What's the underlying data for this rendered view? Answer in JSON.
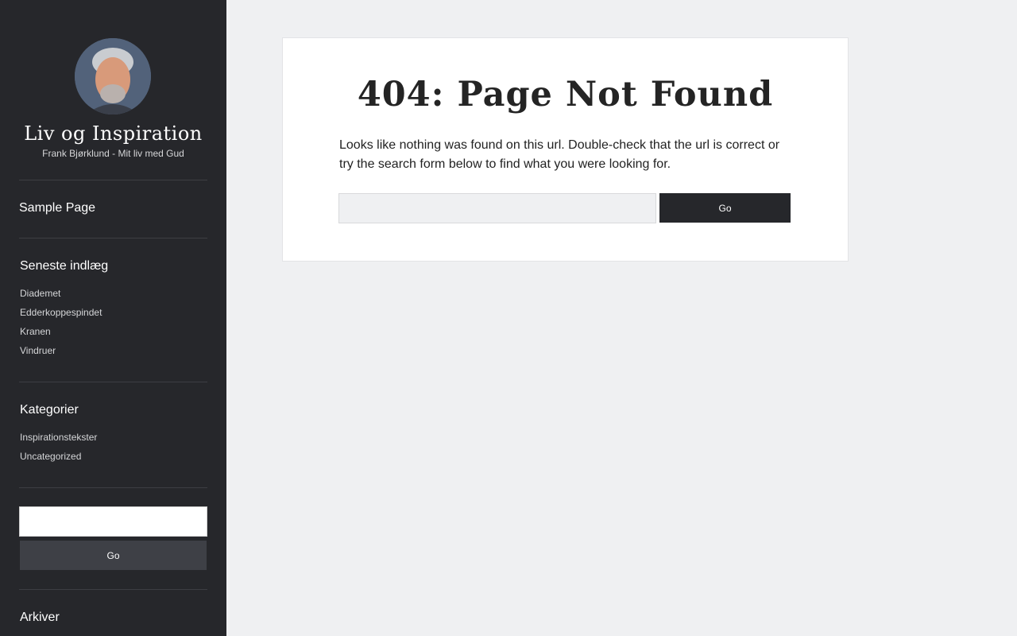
{
  "sidebar": {
    "site_title": "Liv og Inspiration",
    "site_description": "Frank Bjørklund - Mit liv med Gud",
    "nav": {
      "sample_page": "Sample Page"
    },
    "recent_posts": {
      "title": "Seneste indlæg",
      "items": [
        "Diademet",
        "Edderkoppespindet",
        "Kranen",
        "Vindruer"
      ]
    },
    "categories": {
      "title": "Kategorier",
      "items": [
        "Inspirationstekster",
        "Uncategorized"
      ]
    },
    "search": {
      "value": "",
      "button_label": "Go"
    },
    "archives": {
      "title": "Arkiver"
    }
  },
  "main": {
    "title": "404: Page Not Found",
    "text": "Looks like nothing was found on this url. Double-check that the url is correct or try the search form below to find what you were looking for.",
    "search": {
      "value": "",
      "button_label": "Go"
    }
  },
  "colors": {
    "sidebar_bg": "#26272b",
    "page_bg": "#eff0f2",
    "button_dark": "#26272b",
    "button_sidebar": "#3e4046"
  }
}
